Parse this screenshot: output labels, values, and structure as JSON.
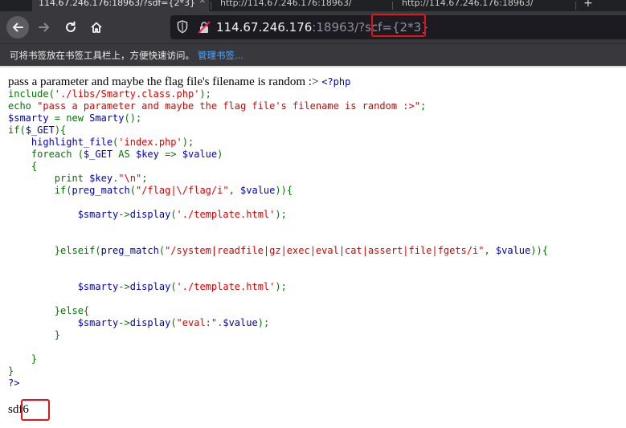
{
  "tabs": [
    {
      "label": "114.67.246.176:18963/?sdf={2*3}",
      "active": true
    },
    {
      "label": "http://114.67.246.176:18963/",
      "active": false
    },
    {
      "label": "http://114.67.246.176:18963/",
      "active": false
    }
  ],
  "newtab_label": "+",
  "nav": {
    "back_icon": "arrow-left-icon",
    "forward_icon": "arrow-right-icon",
    "reload_icon": "reload-icon",
    "home_icon": "home-icon"
  },
  "url": {
    "host": "114.67.246.176",
    "rest_prefix": ":18963/?sc",
    "rest_suffix": "f={2*3}"
  },
  "bookmarks": {
    "hint": "可将书签放在书签工具栏上，方便快速访问。",
    "manage_link": "管理书签..."
  },
  "page": {
    "intro": "pass a parameter and maybe the flag file's filename is random :> ",
    "php_open": "<?php",
    "code_lines": [
      [
        {
          "c": "k",
          "t": "include("
        },
        {
          "c": "s",
          "t": "'./libs/Smarty.class.php'"
        },
        {
          "c": "k",
          "t": ");"
        }
      ],
      [
        {
          "c": "k",
          "t": "echo "
        },
        {
          "c": "s",
          "t": "\"pass a parameter and maybe the flag file's filename is random :>\""
        },
        {
          "c": "k",
          "t": ";"
        }
      ],
      [
        {
          "c": "d",
          "t": "$smarty "
        },
        {
          "c": "k",
          "t": "= new "
        },
        {
          "c": "d",
          "t": "Smarty"
        },
        {
          "c": "k",
          "t": "();"
        }
      ],
      [
        {
          "c": "k",
          "t": "if("
        },
        {
          "c": "d",
          "t": "$_GET"
        },
        {
          "c": "k",
          "t": "){"
        }
      ],
      [
        {
          "c": "d",
          "t": "    highlight_file"
        },
        {
          "c": "k",
          "t": "("
        },
        {
          "c": "s",
          "t": "'index.php'"
        },
        {
          "c": "k",
          "t": ");"
        }
      ],
      [
        {
          "c": "k",
          "t": "    foreach ("
        },
        {
          "c": "d",
          "t": "$_GET "
        },
        {
          "c": "k",
          "t": "AS "
        },
        {
          "c": "d",
          "t": "$key "
        },
        {
          "c": "k",
          "t": "=> "
        },
        {
          "c": "d",
          "t": "$value"
        },
        {
          "c": "k",
          "t": ")"
        }
      ],
      [
        {
          "c": "k",
          "t": "    {"
        }
      ],
      [
        {
          "c": "k",
          "t": "        print "
        },
        {
          "c": "d",
          "t": "$key"
        },
        {
          "c": "k",
          "t": "."
        },
        {
          "c": "s",
          "t": "\"\\n\""
        },
        {
          "c": "k",
          "t": ";"
        }
      ],
      [
        {
          "c": "k",
          "t": "        if("
        },
        {
          "c": "d",
          "t": "preg_match"
        },
        {
          "c": "k",
          "t": "("
        },
        {
          "c": "s",
          "t": "\"/flag|\\/flag/i\""
        },
        {
          "c": "k",
          "t": ", "
        },
        {
          "c": "d",
          "t": "$value"
        },
        {
          "c": "k",
          "t": ")){"
        }
      ],
      [
        {
          "c": "k",
          "t": ""
        }
      ],
      [
        {
          "c": "d",
          "t": "            $smarty"
        },
        {
          "c": "k",
          "t": "->"
        },
        {
          "c": "d",
          "t": "display"
        },
        {
          "c": "k",
          "t": "("
        },
        {
          "c": "s",
          "t": "'./template.html'"
        },
        {
          "c": "k",
          "t": ");"
        }
      ],
      [
        {
          "c": "k",
          "t": ""
        }
      ],
      [
        {
          "c": "k",
          "t": ""
        }
      ],
      [
        {
          "c": "k",
          "t": "        }elseif("
        },
        {
          "c": "d",
          "t": "preg_match"
        },
        {
          "c": "k",
          "t": "("
        },
        {
          "c": "s",
          "t": "\"/system|readfile|gz|exec|eval|cat|assert|file|fgets/i\""
        },
        {
          "c": "k",
          "t": ", "
        },
        {
          "c": "d",
          "t": "$value"
        },
        {
          "c": "k",
          "t": ")){"
        }
      ],
      [
        {
          "c": "k",
          "t": ""
        }
      ],
      [
        {
          "c": "k",
          "t": ""
        }
      ],
      [
        {
          "c": "d",
          "t": "            $smarty"
        },
        {
          "c": "k",
          "t": "->"
        },
        {
          "c": "d",
          "t": "display"
        },
        {
          "c": "k",
          "t": "("
        },
        {
          "c": "s",
          "t": "'./template.html'"
        },
        {
          "c": "k",
          "t": ");"
        }
      ],
      [
        {
          "c": "k",
          "t": ""
        }
      ],
      [
        {
          "c": "k",
          "t": "        }else{"
        }
      ],
      [
        {
          "c": "d",
          "t": "            $smarty"
        },
        {
          "c": "k",
          "t": "->"
        },
        {
          "c": "d",
          "t": "display"
        },
        {
          "c": "k",
          "t": "("
        },
        {
          "c": "s",
          "t": "\"eval:\""
        },
        {
          "c": "k",
          "t": "."
        },
        {
          "c": "d",
          "t": "$value"
        },
        {
          "c": "k",
          "t": ");"
        }
      ],
      [
        {
          "c": "k",
          "t": "        }"
        }
      ],
      [
        {
          "c": "k",
          "t": ""
        }
      ],
      [
        {
          "c": "k",
          "t": "    }"
        }
      ],
      [
        {
          "c": "k",
          "t": "}"
        }
      ],
      [
        {
          "c": "d",
          "t": "?>"
        }
      ]
    ],
    "result_key": "sdf",
    "result_value": "6"
  },
  "colors": {
    "keyword": "#007700",
    "string": "#dd0000",
    "default": "#0000bb",
    "highlight_box": "#e0161a"
  }
}
